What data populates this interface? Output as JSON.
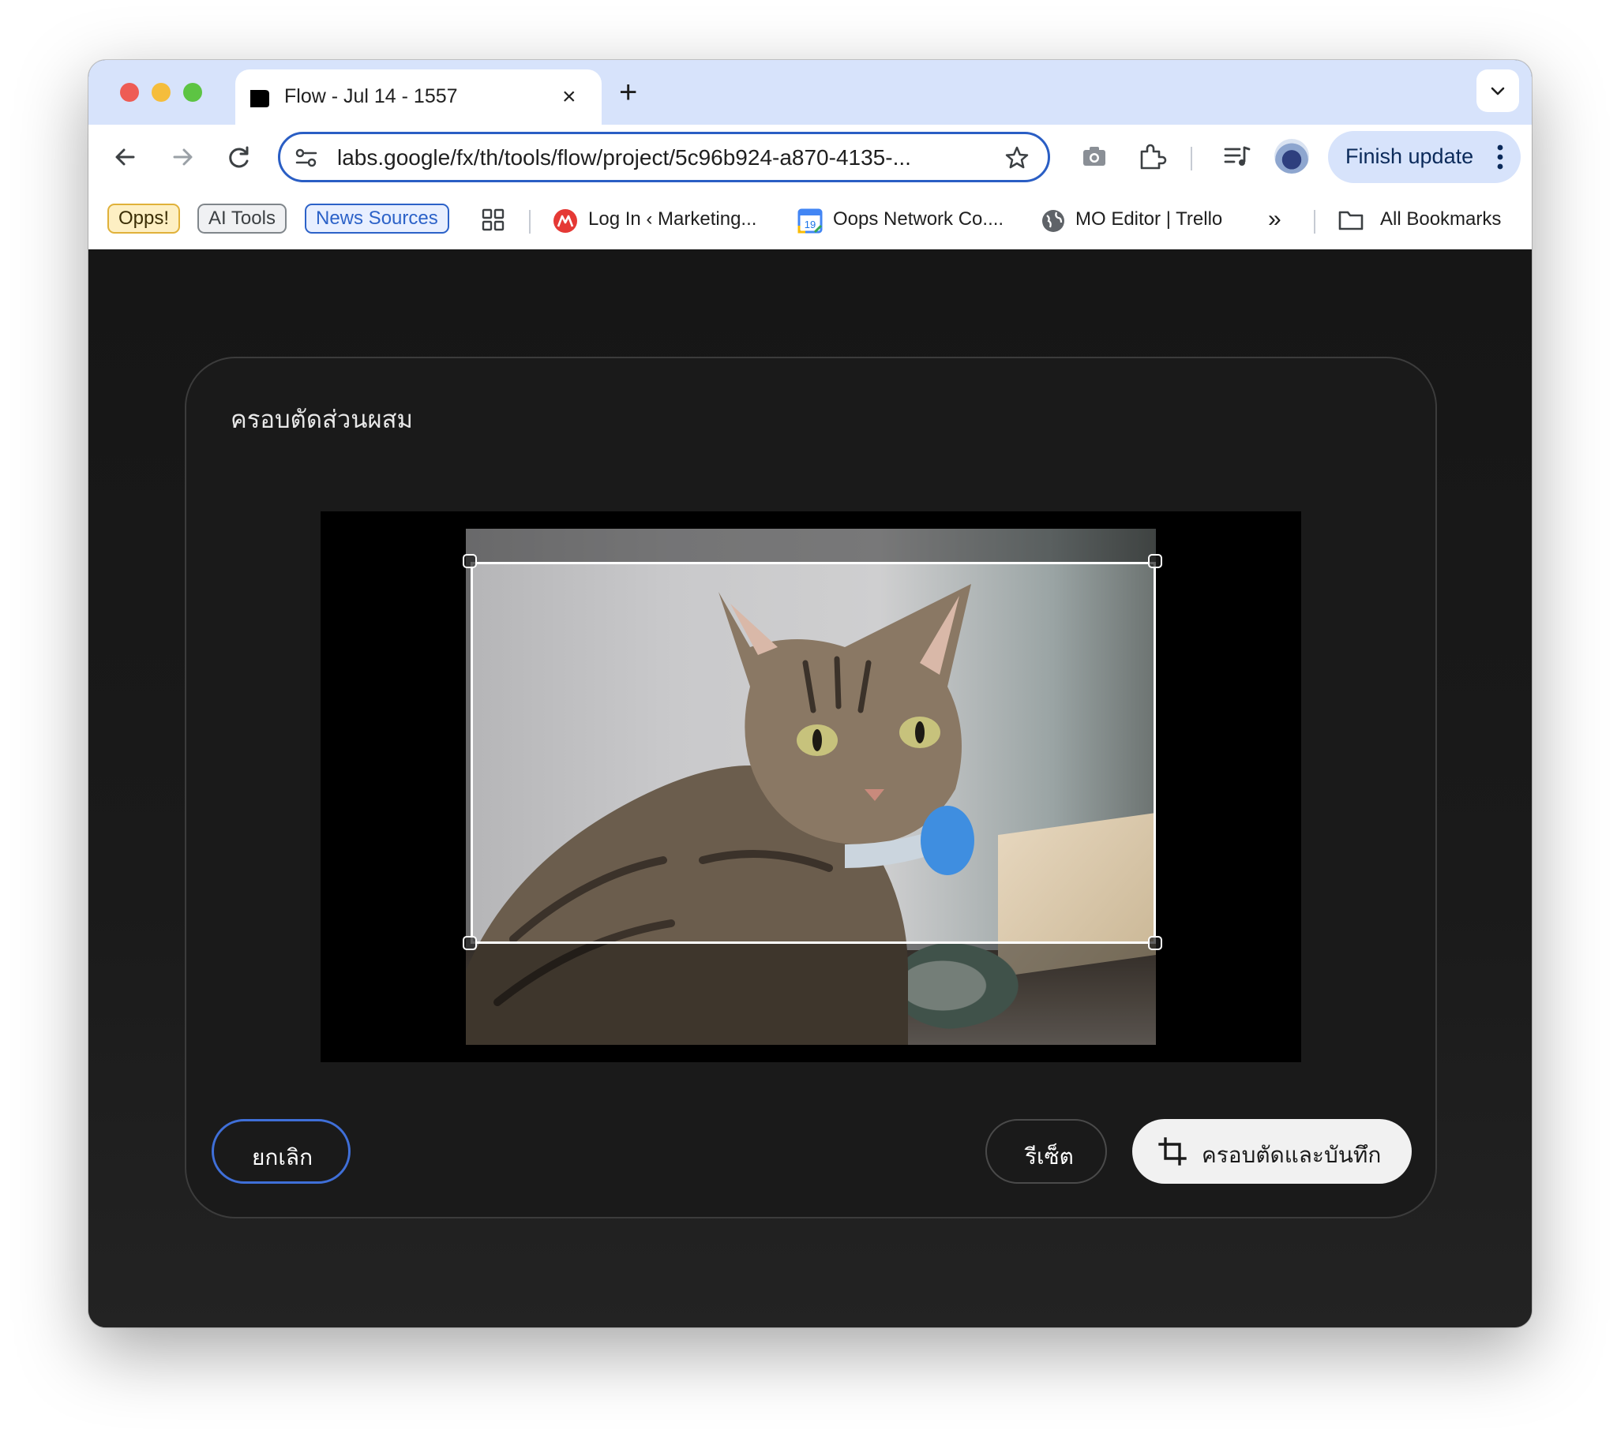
{
  "browser": {
    "tab": {
      "title": "Flow - Jul 14 - 1557",
      "close_icon": "×",
      "new_tab_icon": "+"
    },
    "address_bar": {
      "url": "labs.google/fx/th/tools/flow/project/5c96b924-a870-4135-..."
    },
    "finish_update_label": "Finish update",
    "bookmarks": [
      {
        "label": "Opps!",
        "style": "chip-yellow"
      },
      {
        "label": "AI Tools",
        "style": "chip-gray"
      },
      {
        "label": "News Sources",
        "style": "chip-blue"
      },
      {
        "label": "Log In ‹ Marketing...",
        "icon": "red-brand-icon"
      },
      {
        "label": "Oops Network Co....",
        "icon": "calendar-icon",
        "icon_text": "19"
      },
      {
        "label": "MO Editor | Trello",
        "icon": "globe-icon"
      }
    ],
    "all_bookmarks_label": "All Bookmarks",
    "overflow_label": "»"
  },
  "dialog": {
    "title": "ครอบตัดส่วนผสม",
    "cancel_label": "ยกเลิก",
    "reset_label": "รีเซ็ต",
    "save_label": "ครอบตัดและบันทึก"
  },
  "colors": {
    "tab_strip": "#d7e3fb",
    "accent_blue": "#2a5ec4",
    "dialog_bg": "#1a1a1a",
    "save_button_bg": "#f1f1f1"
  }
}
